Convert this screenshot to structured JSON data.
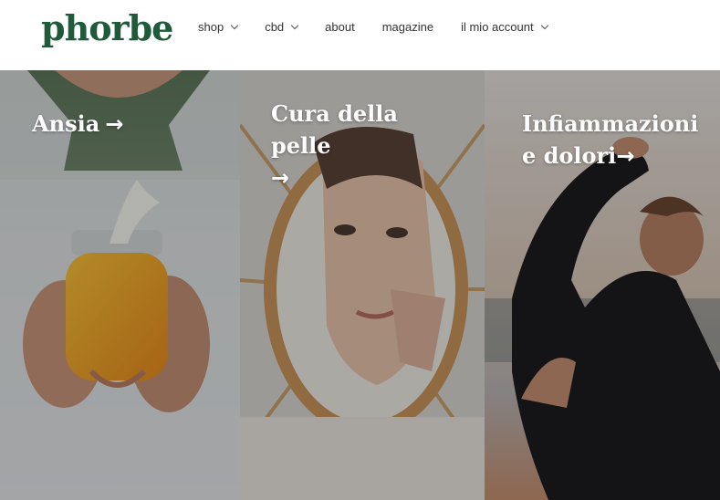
{
  "header": {
    "logo": "phorbe",
    "nav": [
      {
        "label": "shop",
        "has_dropdown": true
      },
      {
        "label": "cbd",
        "has_dropdown": true
      },
      {
        "label": "about",
        "has_dropdown": false
      },
      {
        "label": "magazine",
        "has_dropdown": false
      },
      {
        "label": "il mio account",
        "has_dropdown": true
      }
    ]
  },
  "tiles": [
    {
      "title": "Ansia",
      "arrow": "→"
    },
    {
      "title": "Cura della pelle",
      "arrow": "→"
    },
    {
      "title": "Infiammazioni e dolori",
      "arrow": "→"
    }
  ],
  "colors": {
    "logo": "#1f5a3a",
    "nav_text": "#333333",
    "overlay": "rgba(0,0,0,0.28)"
  }
}
